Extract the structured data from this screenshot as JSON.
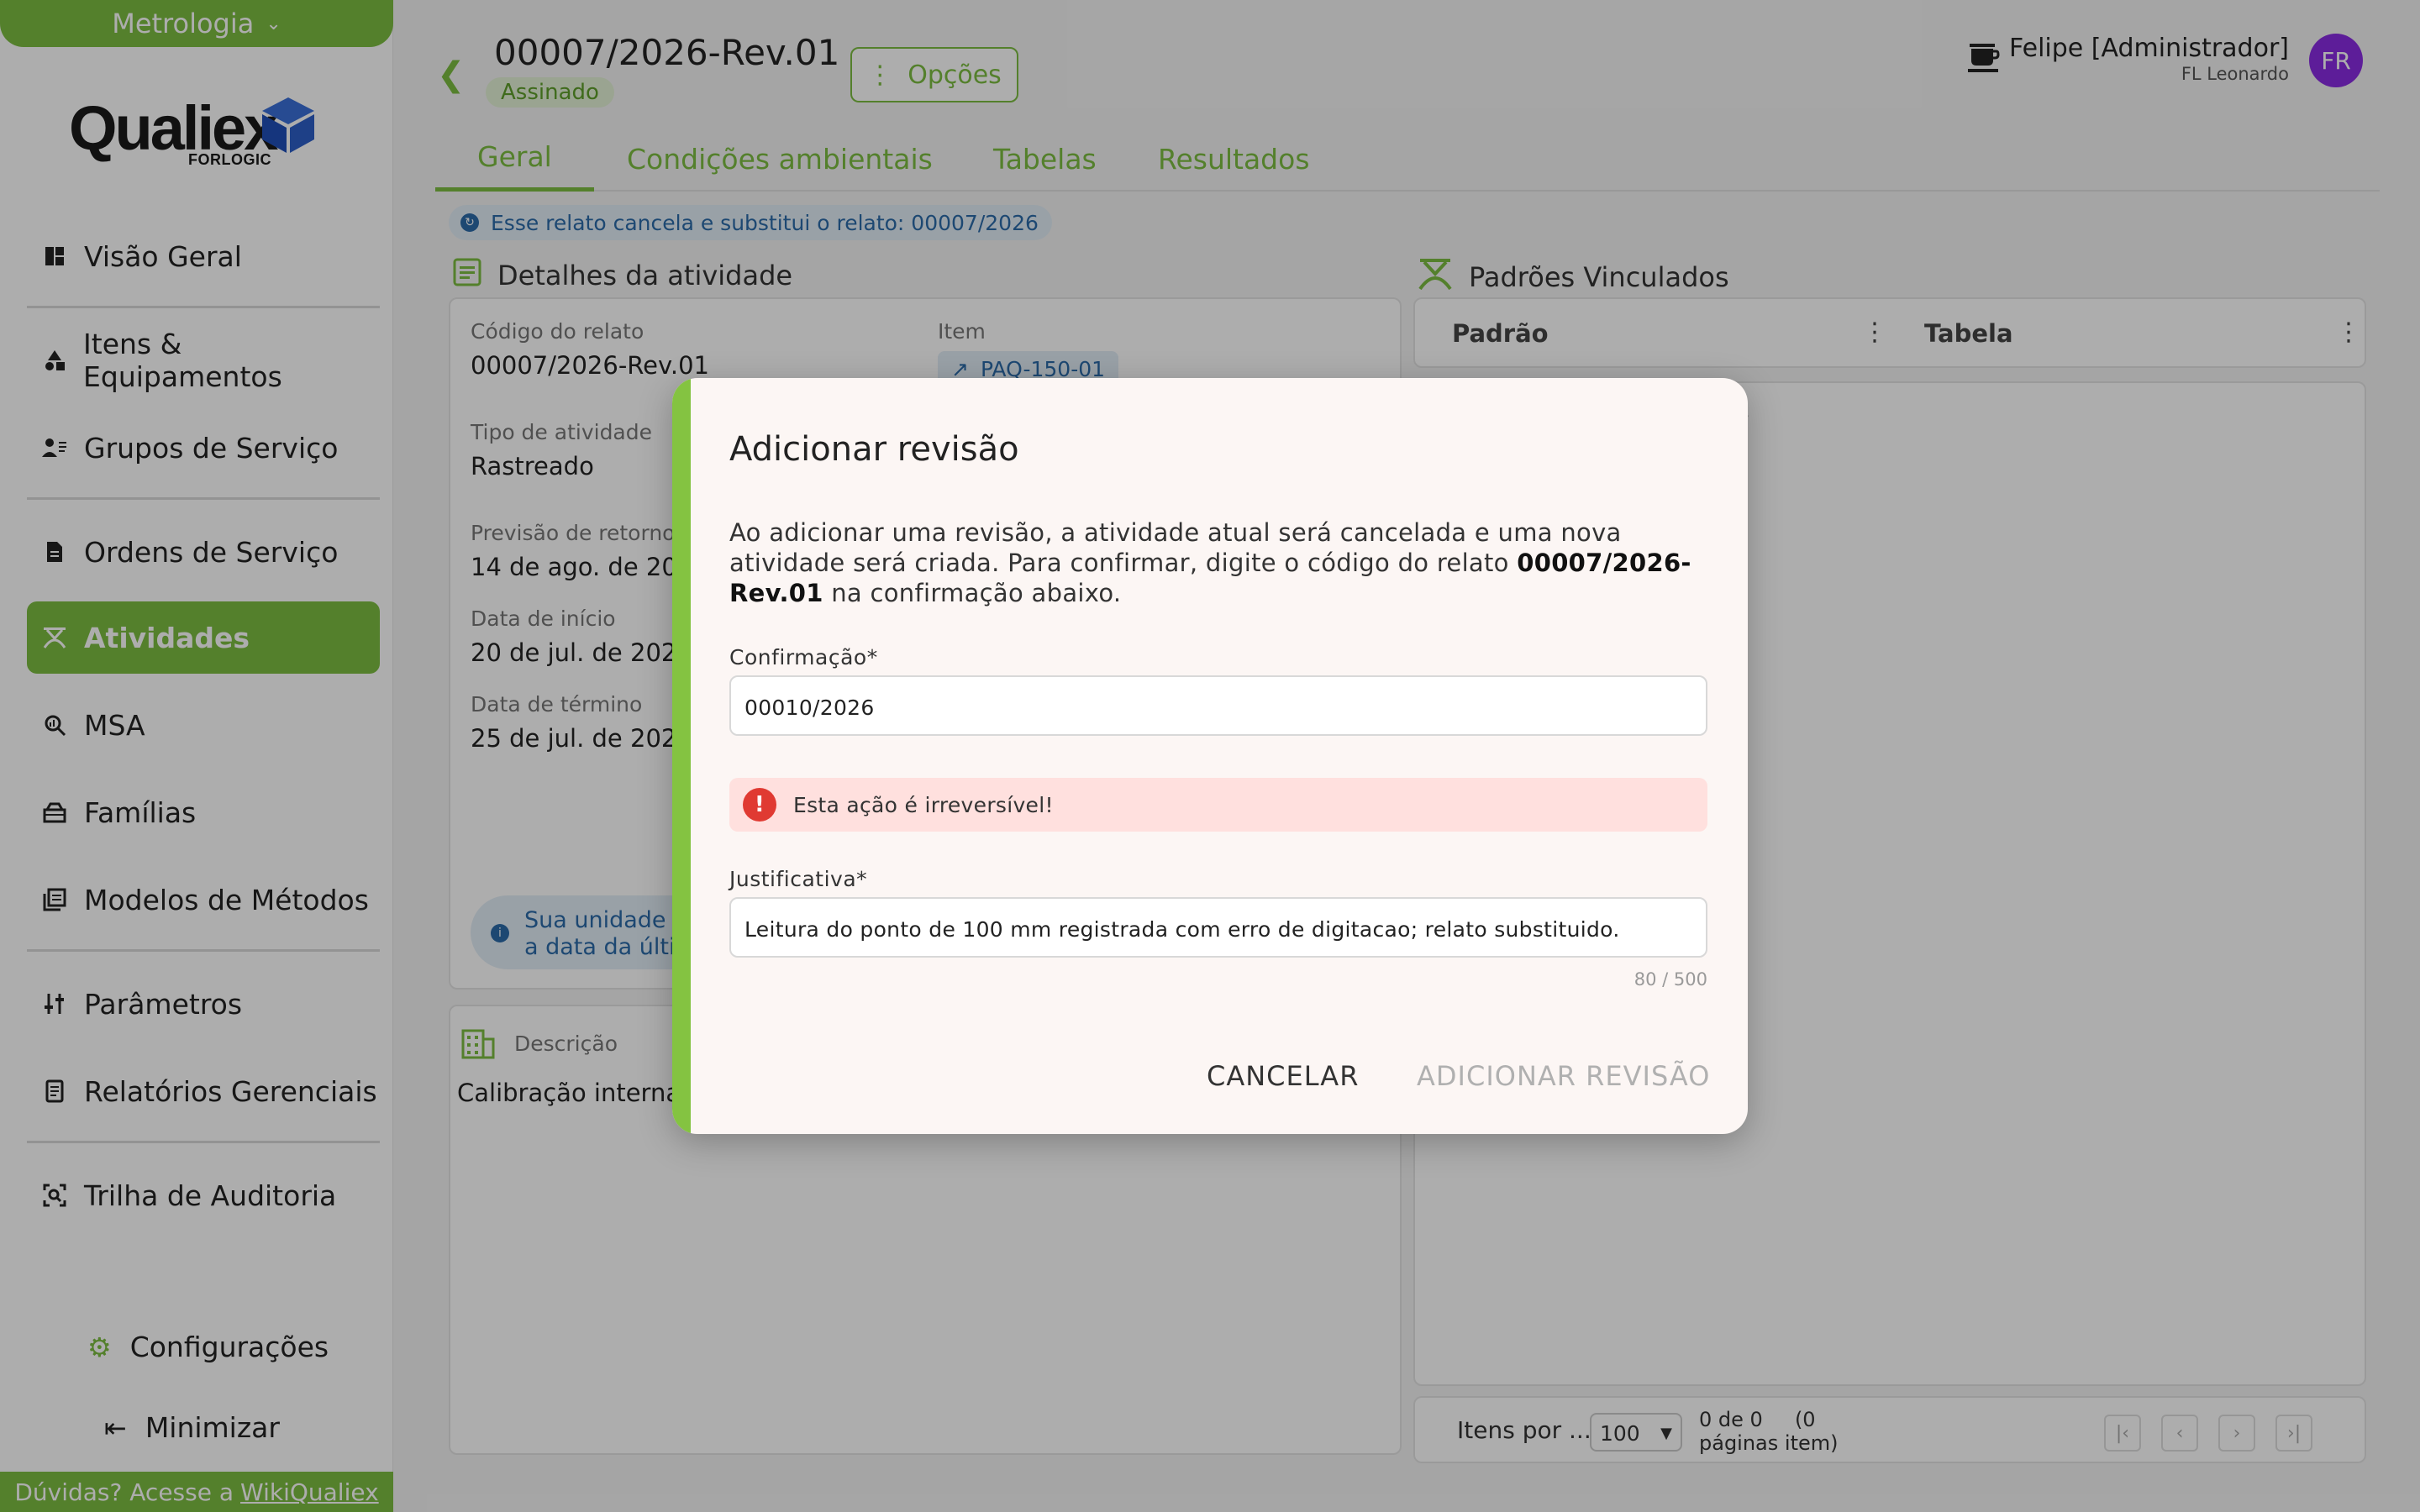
{
  "sidebar": {
    "module": "Metrologia",
    "logo": {
      "word": "Qualiex",
      "sub": "FORLOGIC"
    },
    "items": [
      {
        "label": "Visão Geral",
        "icon": "dashboard-icon"
      },
      {
        "label": "Itens & Equipamentos",
        "icon": "shapes-icon"
      },
      {
        "label": "Grupos de Serviço",
        "icon": "user-group-icon"
      },
      {
        "label": "Ordens de Serviço",
        "icon": "document-icon"
      },
      {
        "label": "Atividades",
        "icon": "activity-icon",
        "active": true
      },
      {
        "label": "MSA",
        "icon": "magnifier-icon"
      },
      {
        "label": "Famílias",
        "icon": "box-icon"
      },
      {
        "label": "Modelos de Métodos",
        "icon": "library-icon"
      },
      {
        "label": "Parâmetros",
        "icon": "sliders-icon"
      },
      {
        "label": "Relatórios Gerenciais",
        "icon": "report-icon"
      },
      {
        "label": "Trilha de Auditoria",
        "icon": "audit-icon"
      }
    ],
    "settings_label": "Configurações",
    "minimize_label": "Minimizar",
    "help_prefix": "Dúvidas? Acesse a",
    "help_link": "WikiQualiex"
  },
  "header": {
    "code": "00007/2026-Rev.01",
    "status": "Assinado",
    "options_label": "Opções",
    "user_name": "Felipe [Administrador]",
    "user_org": "FL Leonardo",
    "avatar_initials": "FR"
  },
  "tabs": [
    "Geral",
    "Condições ambientais",
    "Tabelas",
    "Resultados"
  ],
  "info_chip": "Esse relato cancela e substitui o relato: 00007/2026",
  "details": {
    "title": "Detalhes da atividade",
    "code_label": "Código do relato",
    "code_value": "00007/2026-Rev.01",
    "item_label": "Item",
    "item_value": "PAQ-150-01",
    "type_label": "Tipo de atividade",
    "type_value": "Rastreado",
    "return_label": "Previsão de retorno",
    "return_value": "14 de ago. de 2026",
    "start_label": "Data de início",
    "start_value": "20 de jul. de 2026",
    "end_label": "Data de término",
    "end_value": "25 de jul. de 2026",
    "unit_note_1": "Sua unidade e",
    "unit_note_2": "a data da últim",
    "desc_label": "Descrição",
    "desc_value": "Calibração interna d"
  },
  "standards": {
    "title": "Padrões Vinculados",
    "col_standard": "Padrão",
    "col_table": "Tabela",
    "empty_fragment": "s",
    "items_per_page_label": "Itens por ...",
    "items_per_page": "100",
    "count_line1": "0 de 0     (0",
    "count_line2": "páginas item)"
  },
  "modal": {
    "title": "Adicionar revisão",
    "body_before": "Ao adicionar uma revisão, a atividade atual será cancelada e uma nova atividade será criada. Para confirmar, digite o código do relato ",
    "body_code": "00007/2026-Rev.01",
    "body_after": " na confirmação abaixo.",
    "confirm_label": "Confirmação*",
    "confirm_value": "00010/2026",
    "warning": "Esta ação é irreversível!",
    "justification_label": "Justificativa*",
    "justification_value": "Leitura do ponto de 100 mm registrada com erro de digitacao; relato substituido.",
    "char_count": "80 / 500",
    "cancel_label": "CANCELAR",
    "add_label": "ADICIONAR REVISÃO"
  },
  "colors": {
    "brand_green": "#7cbd42",
    "info_blue": "#2b6aa8",
    "danger_red": "#e03a32",
    "avatar_purple": "#8a2be2"
  }
}
